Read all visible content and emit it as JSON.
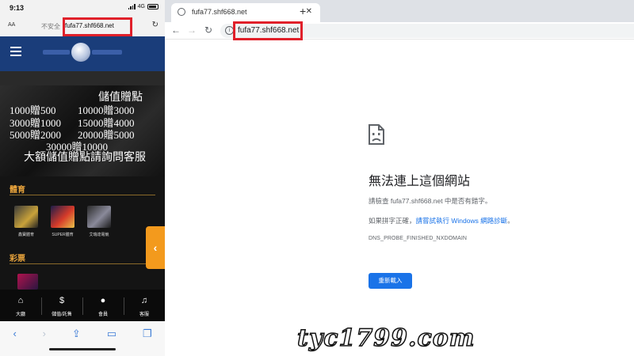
{
  "mobile": {
    "status_time": "9:13",
    "network": "4G",
    "url_bar": {
      "aa": "AA",
      "insecure": "不安全",
      "url": "fufa77.shf668.net"
    },
    "banner": {
      "title": "儲值贈點",
      "lines": [
        "1000贈500",
        "10000贈3000",
        "3000贈1000",
        "15000贈4000",
        "5000贈2000",
        "20000贈5000",
        "30000贈10000"
      ],
      "cta": "大額儲值贈點請詢問客服"
    },
    "sections": {
      "sports": "體育",
      "lottery": "彩票"
    },
    "games": [
      {
        "label": "鑫寶體育"
      },
      {
        "label": "SUPER體育"
      },
      {
        "label": "艾瑞達電競"
      }
    ],
    "nav": [
      {
        "label": "大廳",
        "icon": "home-icon"
      },
      {
        "label": "儲值/託售",
        "icon": "money-icon"
      },
      {
        "label": "會員",
        "icon": "user-icon"
      },
      {
        "label": "客服",
        "icon": "headset-icon"
      }
    ]
  },
  "browser": {
    "tab_title": "fufa77.shf668.net",
    "url": "fufa77.shf668.net"
  },
  "error": {
    "title": "無法連上這個網站",
    "line1": "請檢查 fufa77.shf668.net 中是否有錯字。",
    "line2_prefix": "如果拼字正確，",
    "line2_link": "請嘗試執行 Windows 網路診斷",
    "line2_suffix": "。",
    "code": "DNS_PROBE_FINISHED_NXDOMAIN",
    "reload_label": "重新載入"
  },
  "watermark": "tyc1799.com",
  "colors": {
    "highlight": "#e0202a",
    "accent_orange": "#f39a1d",
    "chrome_blue": "#1a73e8",
    "site_header": "#1a3d7a"
  }
}
